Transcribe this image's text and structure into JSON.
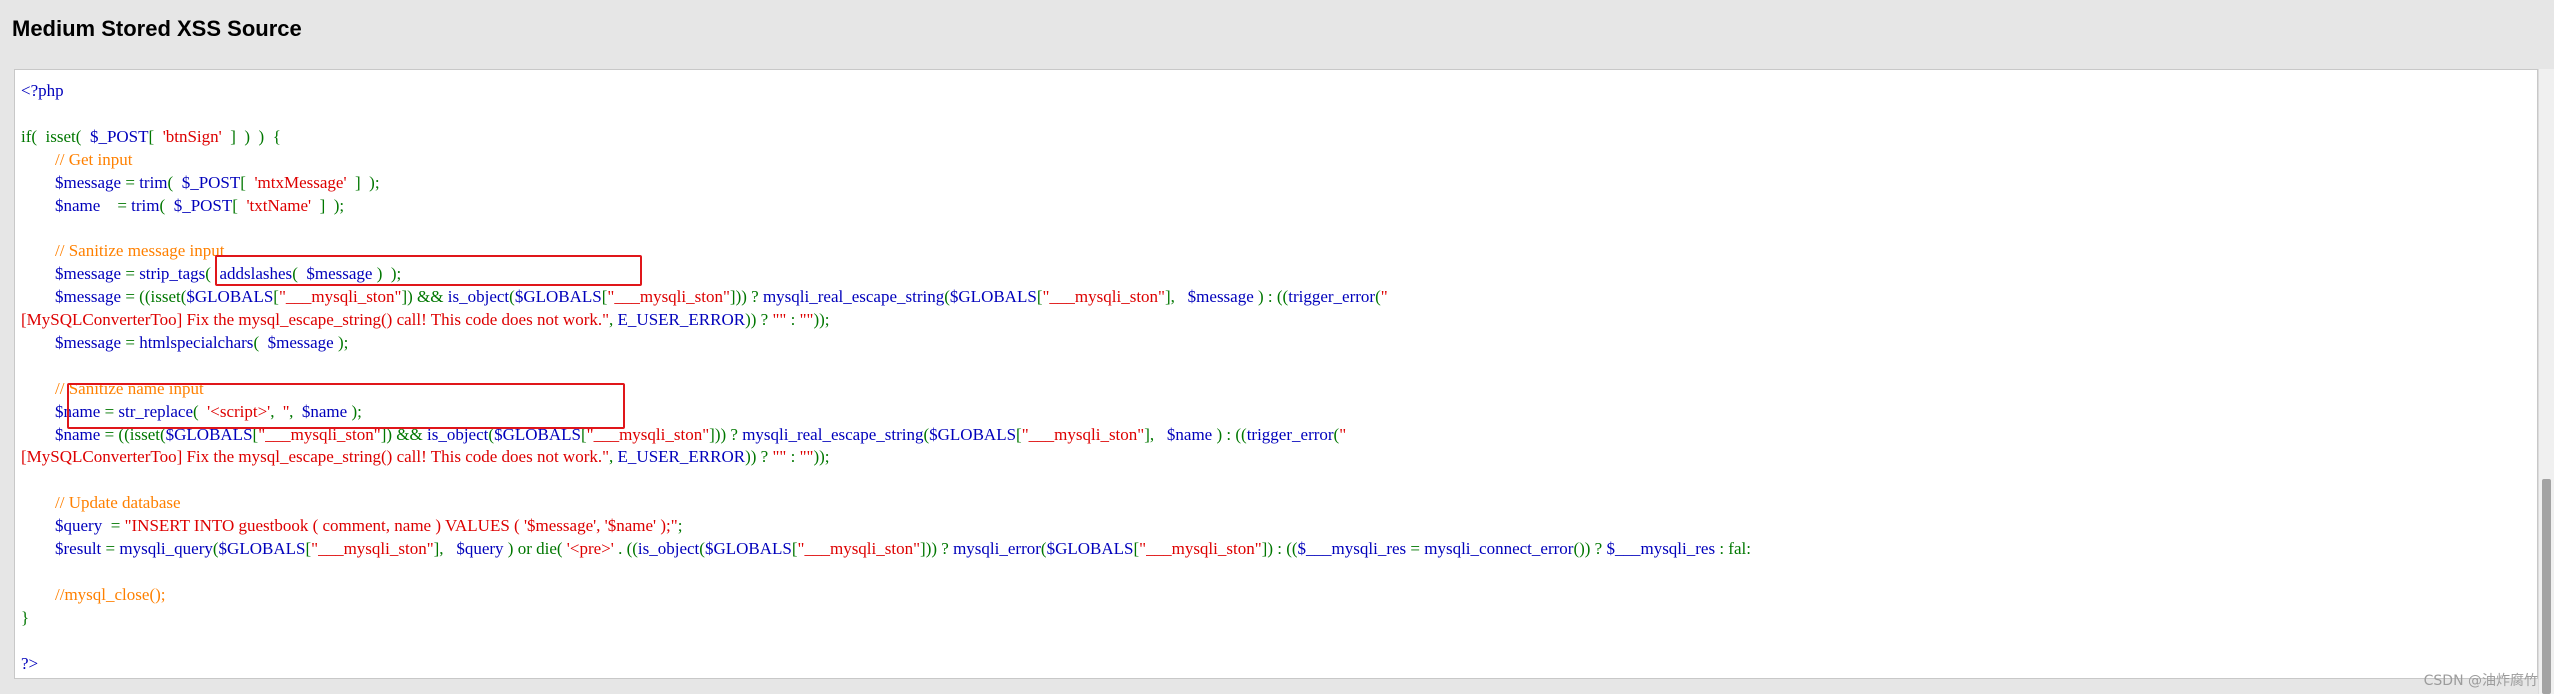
{
  "page": {
    "title": "Medium Stored XSS Source"
  },
  "code": {
    "lines": [
      {
        "segments": [
          {
            "text": "<?php",
            "type": "default"
          }
        ]
      },
      {
        "segments": []
      },
      {
        "segments": [
          {
            "text": "if(  isset(  ",
            "type": "keyword"
          },
          {
            "text": "$_POST",
            "type": "default"
          },
          {
            "text": "[  ",
            "type": "keyword"
          },
          {
            "text": "'btnSign'",
            "type": "string"
          },
          {
            "text": "  ]  )  )  {",
            "type": "keyword"
          }
        ]
      },
      {
        "segments": [
          {
            "text": "        // Get input",
            "type": "comment"
          }
        ]
      },
      {
        "segments": [
          {
            "text": "        $message ",
            "type": "default"
          },
          {
            "text": "= ",
            "type": "keyword"
          },
          {
            "text": "trim",
            "type": "default"
          },
          {
            "text": "(  ",
            "type": "keyword"
          },
          {
            "text": "$_POST",
            "type": "default"
          },
          {
            "text": "[  ",
            "type": "keyword"
          },
          {
            "text": "'mtxMessage'",
            "type": "string"
          },
          {
            "text": "  ]  );",
            "type": "keyword"
          }
        ]
      },
      {
        "segments": [
          {
            "text": "        $name    ",
            "type": "default"
          },
          {
            "text": "= ",
            "type": "keyword"
          },
          {
            "text": "trim",
            "type": "default"
          },
          {
            "text": "(  ",
            "type": "keyword"
          },
          {
            "text": "$_POST",
            "type": "default"
          },
          {
            "text": "[  ",
            "type": "keyword"
          },
          {
            "text": "'txtName'",
            "type": "string"
          },
          {
            "text": "  ]  );",
            "type": "keyword"
          }
        ]
      },
      {
        "segments": []
      },
      {
        "segments": [
          {
            "text": "        // Sanitize message input",
            "type": "comment"
          }
        ]
      },
      {
        "segments": [
          {
            "text": "        $message ",
            "type": "default"
          },
          {
            "text": "= ",
            "type": "keyword"
          },
          {
            "text": "strip_tags",
            "type": "default"
          },
          {
            "text": "(  ",
            "type": "keyword"
          },
          {
            "text": "addslashes",
            "type": "default"
          },
          {
            "text": "(  ",
            "type": "keyword"
          },
          {
            "text": "$message ",
            "type": "default"
          },
          {
            "text": ")  );",
            "type": "keyword"
          }
        ]
      },
      {
        "segments": [
          {
            "text": "        $message ",
            "type": "default"
          },
          {
            "text": "= ((isset(",
            "type": "keyword"
          },
          {
            "text": "$GLOBALS",
            "type": "default"
          },
          {
            "text": "[",
            "type": "keyword"
          },
          {
            "text": "\"___mysqli_ston\"",
            "type": "string"
          },
          {
            "text": "]) && ",
            "type": "keyword"
          },
          {
            "text": "is_object",
            "type": "default"
          },
          {
            "text": "(",
            "type": "keyword"
          },
          {
            "text": "$GLOBALS",
            "type": "default"
          },
          {
            "text": "[",
            "type": "keyword"
          },
          {
            "text": "\"___mysqli_ston\"",
            "type": "string"
          },
          {
            "text": "])) ? ",
            "type": "keyword"
          },
          {
            "text": "mysqli_real_escape_string",
            "type": "default"
          },
          {
            "text": "(",
            "type": "keyword"
          },
          {
            "text": "$GLOBALS",
            "type": "default"
          },
          {
            "text": "[",
            "type": "keyword"
          },
          {
            "text": "\"___mysqli_ston\"",
            "type": "string"
          },
          {
            "text": "],   ",
            "type": "keyword"
          },
          {
            "text": "$message ",
            "type": "default"
          },
          {
            "text": ") : ((",
            "type": "keyword"
          },
          {
            "text": "trigger_error",
            "type": "default"
          },
          {
            "text": "(",
            "type": "keyword"
          },
          {
            "text": "\"",
            "type": "string"
          }
        ]
      },
      {
        "segments": [
          {
            "text": "[MySQLConverterToo] Fix the mysql_escape_string() call! This code does not work.\"",
            "type": "string"
          },
          {
            "text": ", ",
            "type": "keyword"
          },
          {
            "text": "E_USER_ERROR",
            "type": "default"
          },
          {
            "text": ")) ? ",
            "type": "keyword"
          },
          {
            "text": "\"\" ",
            "type": "string"
          },
          {
            "text": ": ",
            "type": "keyword"
          },
          {
            "text": "\"\"",
            "type": "string"
          },
          {
            "text": "));",
            "type": "keyword"
          }
        ]
      },
      {
        "segments": [
          {
            "text": "        $message ",
            "type": "default"
          },
          {
            "text": "= ",
            "type": "keyword"
          },
          {
            "text": "htmlspecialchars",
            "type": "default"
          },
          {
            "text": "(  ",
            "type": "keyword"
          },
          {
            "text": "$message ",
            "type": "default"
          },
          {
            "text": ");",
            "type": "keyword"
          }
        ]
      },
      {
        "segments": []
      },
      {
        "segments": [
          {
            "text": "        // Sanitize name input",
            "type": "comment"
          }
        ]
      },
      {
        "segments": [
          {
            "text": "        $name ",
            "type": "default"
          },
          {
            "text": "= ",
            "type": "keyword"
          },
          {
            "text": "str_replace",
            "type": "default"
          },
          {
            "text": "(  ",
            "type": "keyword"
          },
          {
            "text": "'<script>'",
            "type": "string"
          },
          {
            "text": ",  ",
            "type": "keyword"
          },
          {
            "text": "''",
            "type": "string"
          },
          {
            "text": ",  ",
            "type": "keyword"
          },
          {
            "text": "$name ",
            "type": "default"
          },
          {
            "text": ");",
            "type": "keyword"
          }
        ]
      },
      {
        "segments": [
          {
            "text": "        $name ",
            "type": "default"
          },
          {
            "text": "= ((isset(",
            "type": "keyword"
          },
          {
            "text": "$GLOBALS",
            "type": "default"
          },
          {
            "text": "[",
            "type": "keyword"
          },
          {
            "text": "\"___mysqli_ston\"",
            "type": "string"
          },
          {
            "text": "]) && ",
            "type": "keyword"
          },
          {
            "text": "is_object",
            "type": "default"
          },
          {
            "text": "(",
            "type": "keyword"
          },
          {
            "text": "$GLOBALS",
            "type": "default"
          },
          {
            "text": "[",
            "type": "keyword"
          },
          {
            "text": "\"___mysqli_ston\"",
            "type": "string"
          },
          {
            "text": "])) ? ",
            "type": "keyword"
          },
          {
            "text": "mysqli_real_escape_string",
            "type": "default"
          },
          {
            "text": "(",
            "type": "keyword"
          },
          {
            "text": "$GLOBALS",
            "type": "default"
          },
          {
            "text": "[",
            "type": "keyword"
          },
          {
            "text": "\"___mysqli_ston\"",
            "type": "string"
          },
          {
            "text": "],   ",
            "type": "keyword"
          },
          {
            "text": "$name ",
            "type": "default"
          },
          {
            "text": ") : ((",
            "type": "keyword"
          },
          {
            "text": "trigger_error",
            "type": "default"
          },
          {
            "text": "(",
            "type": "keyword"
          },
          {
            "text": "\"",
            "type": "string"
          }
        ]
      },
      {
        "segments": [
          {
            "text": "[MySQLConverterToo] Fix the mysql_escape_string() call! This code does not work.\"",
            "type": "string"
          },
          {
            "text": ", ",
            "type": "keyword"
          },
          {
            "text": "E_USER_ERROR",
            "type": "default"
          },
          {
            "text": ")) ? ",
            "type": "keyword"
          },
          {
            "text": "\"\" ",
            "type": "string"
          },
          {
            "text": ": ",
            "type": "keyword"
          },
          {
            "text": "\"\"",
            "type": "string"
          },
          {
            "text": "));",
            "type": "keyword"
          }
        ]
      },
      {
        "segments": []
      },
      {
        "segments": [
          {
            "text": "        // Update database",
            "type": "comment"
          }
        ]
      },
      {
        "segments": [
          {
            "text": "        $query  ",
            "type": "default"
          },
          {
            "text": "= ",
            "type": "keyword"
          },
          {
            "text": "\"INSERT INTO guestbook ( comment, name ) VALUES ( '$message', '$name' );\"",
            "type": "string"
          },
          {
            "text": ";",
            "type": "keyword"
          }
        ]
      },
      {
        "segments": [
          {
            "text": "        $result ",
            "type": "default"
          },
          {
            "text": "= ",
            "type": "keyword"
          },
          {
            "text": "mysqli_query",
            "type": "default"
          },
          {
            "text": "(",
            "type": "keyword"
          },
          {
            "text": "$GLOBALS",
            "type": "default"
          },
          {
            "text": "[",
            "type": "keyword"
          },
          {
            "text": "\"___mysqli_ston\"",
            "type": "string"
          },
          {
            "text": "],   ",
            "type": "keyword"
          },
          {
            "text": "$query ",
            "type": "default"
          },
          {
            "text": ") or die( ",
            "type": "keyword"
          },
          {
            "text": "'<pre>' ",
            "type": "string"
          },
          {
            "text": ". ((",
            "type": "keyword"
          },
          {
            "text": "is_object",
            "type": "default"
          },
          {
            "text": "(",
            "type": "keyword"
          },
          {
            "text": "$GLOBALS",
            "type": "default"
          },
          {
            "text": "[",
            "type": "keyword"
          },
          {
            "text": "\"___mysqli_ston\"",
            "type": "string"
          },
          {
            "text": "])) ? ",
            "type": "keyword"
          },
          {
            "text": "mysqli_error",
            "type": "default"
          },
          {
            "text": "(",
            "type": "keyword"
          },
          {
            "text": "$GLOBALS",
            "type": "default"
          },
          {
            "text": "[",
            "type": "keyword"
          },
          {
            "text": "\"___mysqli_ston\"",
            "type": "string"
          },
          {
            "text": "]) : ((",
            "type": "keyword"
          },
          {
            "text": "$___mysqli_res ",
            "type": "default"
          },
          {
            "text": "= ",
            "type": "keyword"
          },
          {
            "text": "mysqli_connect_error",
            "type": "default"
          },
          {
            "text": "()) ? ",
            "type": "keyword"
          },
          {
            "text": "$___mysqli_res ",
            "type": "default"
          },
          {
            "text": ": fal:",
            "type": "keyword"
          }
        ]
      },
      {
        "segments": []
      },
      {
        "segments": [
          {
            "text": "        //mysql_close();",
            "type": "comment"
          }
        ]
      },
      {
        "segments": [
          {
            "text": "}",
            "type": "keyword"
          }
        ]
      },
      {
        "segments": []
      },
      {
        "segments": [
          {
            "text": "?>",
            "type": "default"
          }
        ]
      }
    ]
  },
  "watermark": "CSDN @油炸腐竹",
  "colors": {
    "default": "#0000bb",
    "keyword": "#007700",
    "string": "#dd0000",
    "comment": "#ff8000",
    "highlight": "#e0161a"
  }
}
